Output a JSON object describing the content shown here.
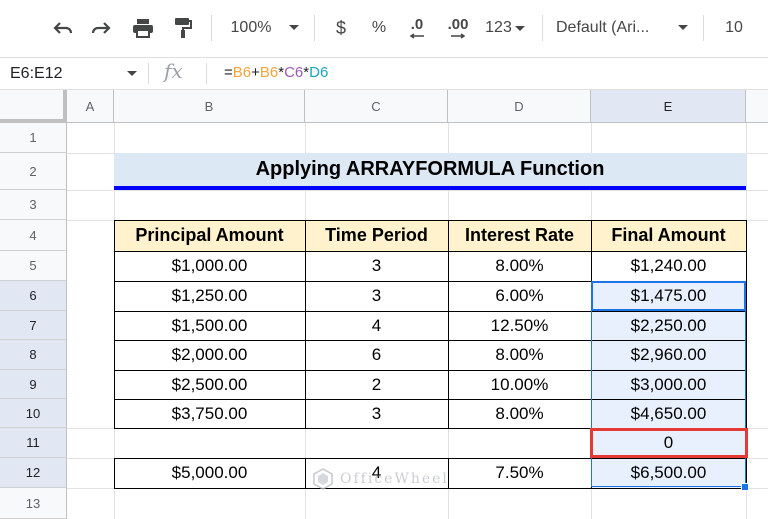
{
  "toolbar": {
    "zoom": "100%",
    "currency": "$",
    "percent": "%",
    "decrease_decimal": ".0",
    "increase_decimal": ".00",
    "more_formats": "123",
    "font": "Default (Ari...",
    "font_size": "10"
  },
  "formula_bar": {
    "name_box": "E6:E12",
    "fx": "fx",
    "formula_parts": [
      {
        "text": "=",
        "color": "#202124"
      },
      {
        "text": "B6",
        "color": "#f4a33a"
      },
      {
        "text": "+",
        "color": "#202124"
      },
      {
        "text": "B6",
        "color": "#f4a33a"
      },
      {
        "text": "*",
        "color": "#202124"
      },
      {
        "text": "C6",
        "color": "#9b59b6"
      },
      {
        "text": "*",
        "color": "#202124"
      },
      {
        "text": "D6",
        "color": "#1aa3c4"
      }
    ]
  },
  "columns": [
    "A",
    "B",
    "C",
    "D",
    "E"
  ],
  "rows": [
    "1",
    "2",
    "3",
    "4",
    "5",
    "6",
    "7",
    "8",
    "9",
    "10",
    "11",
    "12",
    "13"
  ],
  "sheet": {
    "title": "Applying ARRAYFORMULA Function",
    "headers": [
      "Principal Amount",
      "Time Period",
      "Interest Rate",
      "Final Amount"
    ],
    "data_rows": [
      [
        "$1,000.00",
        "3",
        "8.00%",
        "$1,240.00"
      ],
      [
        "$1,250.00",
        "3",
        "6.00%",
        "$1,475.00"
      ],
      [
        "$1,500.00",
        "4",
        "12.50%",
        "$2,250.00"
      ],
      [
        "$2,000.00",
        "6",
        "8.00%",
        "$2,960.00"
      ],
      [
        "$2,500.00",
        "2",
        "10.00%",
        "$3,000.00"
      ],
      [
        "$3,750.00",
        "3",
        "8.00%",
        "$4,650.00"
      ],
      [
        "",
        "",
        "",
        "0"
      ],
      [
        "$5,000.00",
        "4",
        "7.50%",
        "$6,500.00"
      ]
    ]
  },
  "watermark": "OfficeWheel",
  "colors": {
    "header_fill": "#fff2cc",
    "title_fill": "#dce9f5",
    "title_underline": "#0000ff",
    "selection": "#1a73e8",
    "highlight": "#e53935"
  }
}
